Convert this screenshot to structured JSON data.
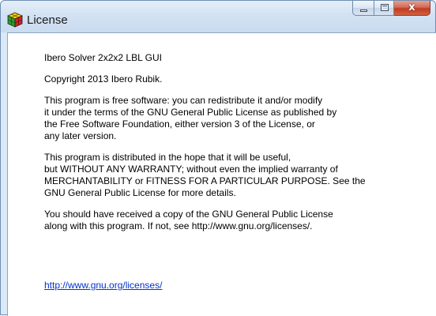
{
  "window": {
    "title": "License",
    "buttons": {
      "minimize": "minimize",
      "maximize": "maximize",
      "close": "x"
    }
  },
  "content": {
    "app_name": "Ibero Solver 2x2x2 LBL GUI",
    "copyright": "Copyright 2013 Ibero Rubik.",
    "paragraph_free": "This program is free software: you can redistribute it and/or modify\nit under the terms of the GNU General Public License as published by\nthe Free Software Foundation, either version 3 of the License, or\nany later version.",
    "paragraph_warranty": "This program is distributed in the hope that it will be useful,\nbut WITHOUT ANY WARRANTY; without even the implied warranty of\nMERCHANTABILITY or FITNESS FOR A PARTICULAR PURPOSE.  See the\nGNU General Public License for more details.",
    "paragraph_copy": "You should have received a copy of the GNU General Public License\nalong with this program.  If not, see http://www.gnu.org/licenses/.",
    "link_text": "http://www.gnu.org/licenses/"
  },
  "icons": {
    "app_icon": "rubiks-cube-icon",
    "close_glyph": "close-icon"
  },
  "colors": {
    "link": "#0033cc",
    "close_button": "#c9452c",
    "title_bar": "#d3e2f3"
  }
}
